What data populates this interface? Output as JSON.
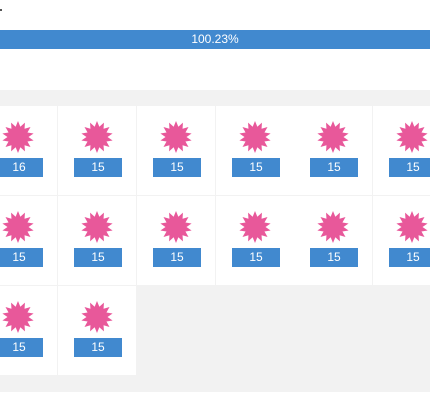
{
  "progress": {
    "label": "100.23%",
    "fill_fraction": 1.0,
    "color": "#4189cf"
  },
  "grid": {
    "icon_name": "starburst-icon",
    "icon_color": "#e8589a",
    "label_color": "#4189cf",
    "cells": [
      {
        "count": "16"
      },
      {
        "count": "15"
      },
      {
        "count": "15"
      },
      {
        "count": "15"
      },
      {
        "count": "15"
      },
      {
        "count": "15"
      },
      {
        "count": "15"
      },
      {
        "count": "15"
      },
      {
        "count": "15"
      },
      {
        "count": "15"
      },
      {
        "count": "15"
      },
      {
        "count": "15"
      },
      {
        "count": "15"
      },
      {
        "count": "15"
      }
    ]
  }
}
